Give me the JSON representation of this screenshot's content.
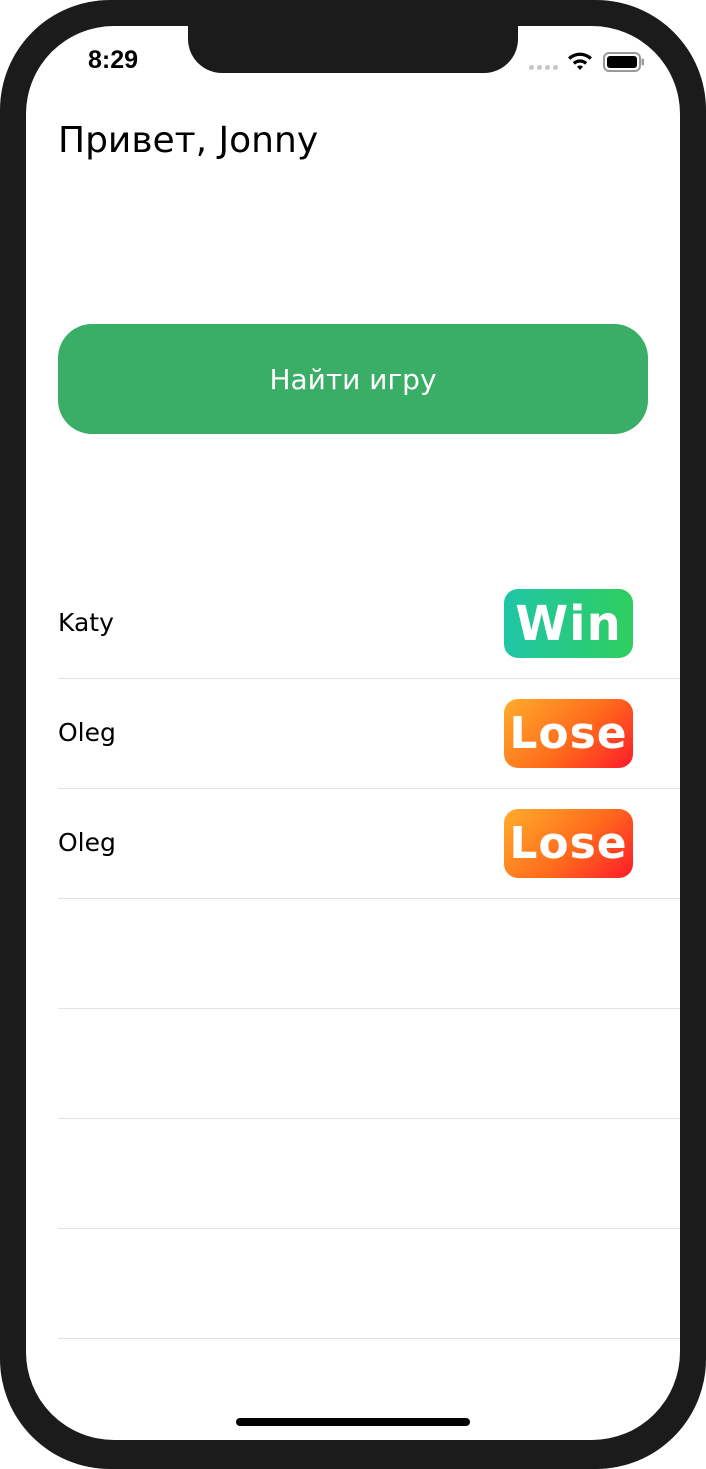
{
  "status_bar": {
    "time": "8:29"
  },
  "greeting": "Привет, Jonny",
  "find_game_button": "Найти игру",
  "games": [
    {
      "opponent": "Katy",
      "result": "Win",
      "result_type": "win"
    },
    {
      "opponent": "Oleg",
      "result": "Lose",
      "result_type": "lose"
    },
    {
      "opponent": "Oleg",
      "result": "Lose",
      "result_type": "lose"
    },
    {
      "opponent": "",
      "result": "",
      "result_type": "empty"
    },
    {
      "opponent": "",
      "result": "",
      "result_type": "empty"
    },
    {
      "opponent": "",
      "result": "",
      "result_type": "empty"
    },
    {
      "opponent": "",
      "result": "",
      "result_type": "empty"
    }
  ],
  "colors": {
    "button": "#3aad67",
    "win_gradient": [
      "#1fc6a6",
      "#2fce5f"
    ],
    "lose_gradient": [
      "#ffad2b",
      "#ff1a2a"
    ],
    "separator": "#e3e3e6"
  },
  "icons": {
    "signal": "signal-dots-icon",
    "wifi": "wifi-icon",
    "battery": "battery-icon"
  }
}
